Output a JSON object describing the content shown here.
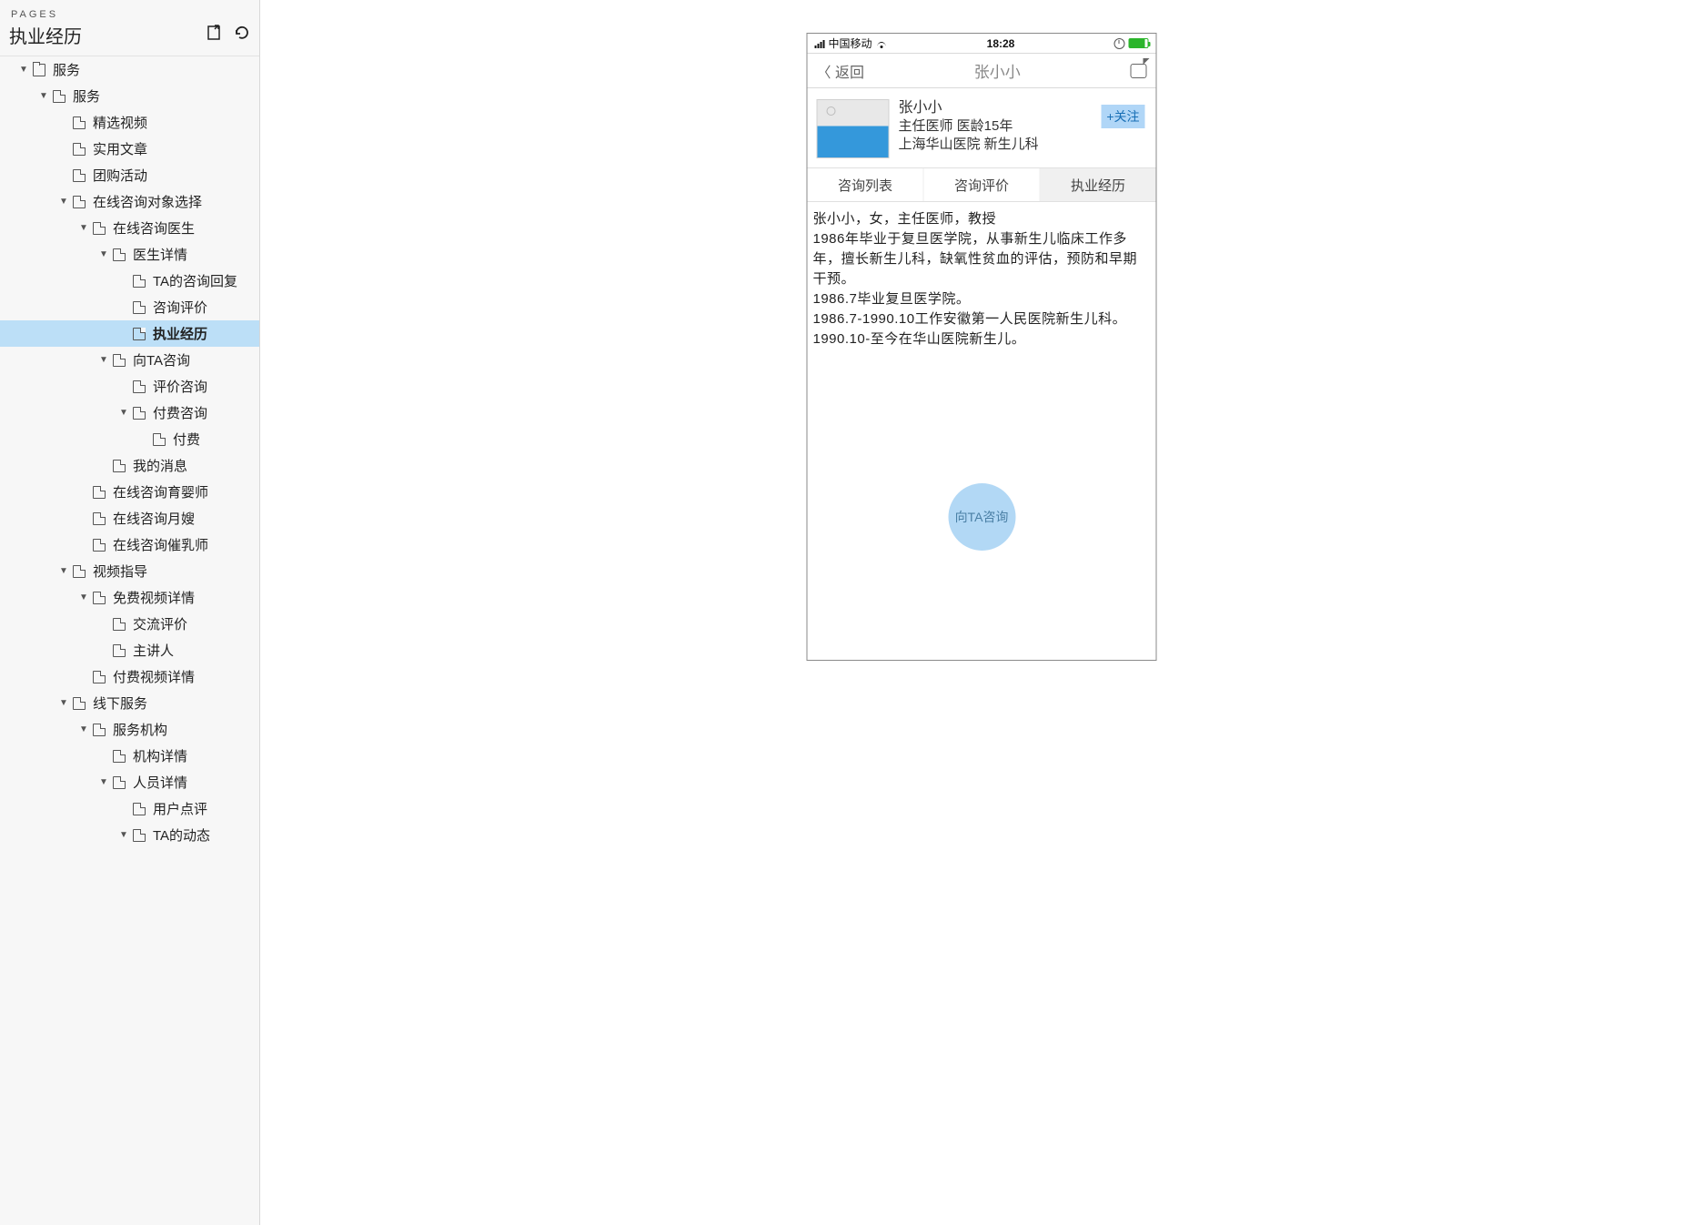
{
  "sidebar": {
    "section_label": "PAGES",
    "header_title": "执业经历",
    "tools": {
      "export": "export-icon",
      "refresh": "refresh-icon"
    },
    "tree": [
      {
        "indent": 0,
        "expand": "▼",
        "icon": "folder",
        "label": "服务"
      },
      {
        "indent": 1,
        "expand": "▼",
        "icon": "page",
        "label": "服务"
      },
      {
        "indent": 2,
        "expand": "",
        "icon": "page",
        "label": "精选视频"
      },
      {
        "indent": 2,
        "expand": "",
        "icon": "page",
        "label": "实用文章"
      },
      {
        "indent": 2,
        "expand": "",
        "icon": "page",
        "label": "团购活动"
      },
      {
        "indent": 2,
        "expand": "▼",
        "icon": "page",
        "label": "在线咨询对象选择"
      },
      {
        "indent": 3,
        "expand": "▼",
        "icon": "page",
        "label": "在线咨询医生"
      },
      {
        "indent": 4,
        "expand": "▼",
        "icon": "page",
        "label": "医生详情"
      },
      {
        "indent": 5,
        "expand": "",
        "icon": "page",
        "label": "TA的咨询回复"
      },
      {
        "indent": 5,
        "expand": "",
        "icon": "page",
        "label": "咨询评价"
      },
      {
        "indent": 5,
        "expand": "",
        "icon": "page",
        "label": "执业经历",
        "selected": true,
        "bold": true
      },
      {
        "indent": 4,
        "expand": "▼",
        "icon": "page",
        "label": "向TA咨询"
      },
      {
        "indent": 5,
        "expand": "",
        "icon": "page",
        "label": "评价咨询"
      },
      {
        "indent": 5,
        "expand": "▼",
        "icon": "page",
        "label": "付费咨询"
      },
      {
        "indent": 6,
        "expand": "",
        "icon": "page",
        "label": "付费"
      },
      {
        "indent": 4,
        "expand": "",
        "icon": "page",
        "label": "我的消息"
      },
      {
        "indent": 3,
        "expand": "",
        "icon": "page",
        "label": "在线咨询育婴师"
      },
      {
        "indent": 3,
        "expand": "",
        "icon": "page",
        "label": "在线咨询月嫂"
      },
      {
        "indent": 3,
        "expand": "",
        "icon": "page",
        "label": "在线咨询催乳师"
      },
      {
        "indent": 2,
        "expand": "▼",
        "icon": "page",
        "label": "视频指导"
      },
      {
        "indent": 3,
        "expand": "▼",
        "icon": "page",
        "label": "免费视频详情"
      },
      {
        "indent": 4,
        "expand": "",
        "icon": "page",
        "label": "交流评价"
      },
      {
        "indent": 4,
        "expand": "",
        "icon": "page",
        "label": "主讲人"
      },
      {
        "indent": 3,
        "expand": "",
        "icon": "page",
        "label": "付费视频详情"
      },
      {
        "indent": 2,
        "expand": "▼",
        "icon": "page",
        "label": "线下服务"
      },
      {
        "indent": 3,
        "expand": "▼",
        "icon": "page",
        "label": "服务机构"
      },
      {
        "indent": 4,
        "expand": "",
        "icon": "page",
        "label": "机构详情"
      },
      {
        "indent": 4,
        "expand": "▼",
        "icon": "page",
        "label": "人员详情"
      },
      {
        "indent": 5,
        "expand": "",
        "icon": "page",
        "label": "用户点评"
      },
      {
        "indent": 5,
        "expand": "▼",
        "icon": "page",
        "label": "TA的动态"
      }
    ]
  },
  "device": {
    "status": {
      "carrier": "中国移动",
      "time": "18:28"
    },
    "nav": {
      "back": "〈 返回",
      "title": "张小小"
    },
    "profile": {
      "name": "张小小",
      "line2": "主任医师  医龄15年",
      "line3": "上海华山医院  新生儿科",
      "follow": "+关注"
    },
    "tabs": [
      {
        "label": "咨询列表",
        "active": false
      },
      {
        "label": "咨询评价",
        "active": false
      },
      {
        "label": "执业经历",
        "active": true
      }
    ],
    "content": [
      "张小小，女，主任医师，教授",
      "1986年毕业于复旦医学院，从事新生儿临床工作多年，擅长新生儿科，缺氧性贫血的评估，预防和早期干预。",
      "1986.7毕业复旦医学院。",
      "1986.7-1990.10工作安徽第一人民医院新生儿科。",
      "1990.10-至今在华山医院新生儿。"
    ],
    "fab": "向TA咨询"
  }
}
